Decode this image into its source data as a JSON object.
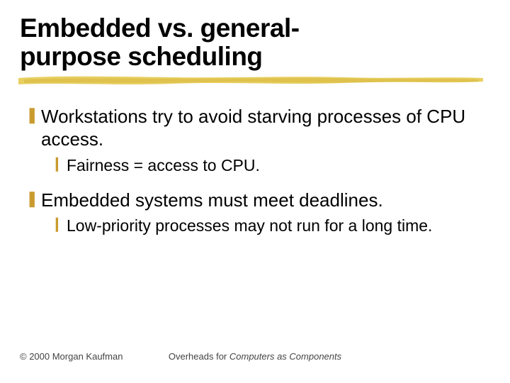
{
  "title_line1": "Embedded vs. general-",
  "title_line2": "purpose scheduling",
  "bullets": {
    "b1": "Workstations try to avoid starving processes of CPU access.",
    "b1a": "Fairness = access to CPU.",
    "b2": "Embedded systems must meet deadlines.",
    "b2a": "Low-priority processes may not run for a long time."
  },
  "footer": {
    "copyright": "© 2000 Morgan Kaufman",
    "center_prefix": "Overheads for ",
    "center_italic": "Computers as Components"
  }
}
